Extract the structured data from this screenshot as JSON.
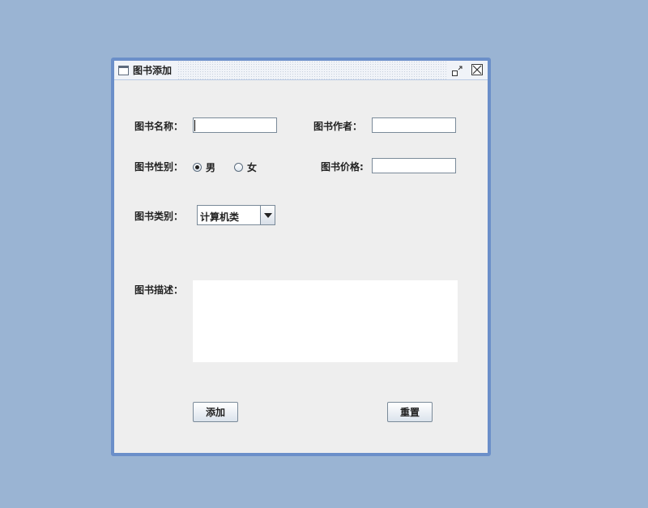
{
  "window": {
    "title": "图书添加"
  },
  "form": {
    "name_label": "图书名称：",
    "name_value": "",
    "author_label": "图书作者：",
    "author_value": "",
    "gender_label": "图书性别：",
    "gender_options": [
      "男",
      "女"
    ],
    "gender_selected": "男",
    "price_label": "图书价格:",
    "price_value": "",
    "category_label": "图书类别：",
    "category_selected": "计算机类",
    "description_label": "图书描述：",
    "description_value": ""
  },
  "buttons": {
    "add": "添加",
    "reset": "重置"
  },
  "icons": {
    "window": "window-icon",
    "restore": "restore-icon",
    "close": "close-icon",
    "dropdown": "chevron-down-icon"
  },
  "colors": {
    "desktop": "#9ab4d3",
    "frame_border": "#6b8fc9",
    "panel": "#eeeeee"
  }
}
